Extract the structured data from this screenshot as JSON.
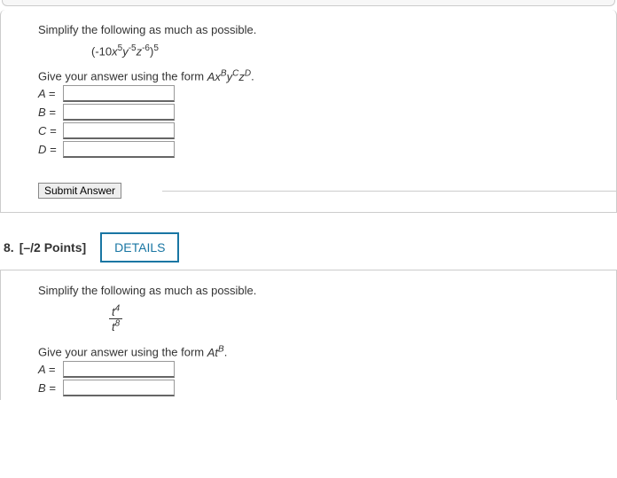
{
  "q7": {
    "prompt": "Simplify the following as much as possible.",
    "expression_html": "(-10<i>x</i><sup>5</sup><i>y</i><sup>-5</sup><i>z</i><sup>-6</sup>)<sup>5</sup>",
    "answer_form_prefix": "Give your answer using the form ",
    "answer_form_expr": "Ax<sup>B</sup>y<sup>C</sup>z<sup>D</sup>",
    "fields": {
      "A": "A =",
      "B": "B =",
      "C": "C =",
      "D": "D ="
    },
    "submit": "Submit Answer"
  },
  "q8": {
    "number": "8.",
    "points": "[–/2 Points]",
    "details": "DETAILS",
    "prompt": "Simplify the following as much as possible.",
    "frac_num": "t<sup>4</sup>",
    "frac_den": "t<sup>8</sup>",
    "answer_form_prefix": "Give your answer using the form ",
    "answer_form_expr": "At<sup>B</sup>",
    "fields": {
      "A": "A =",
      "B": "B ="
    }
  }
}
